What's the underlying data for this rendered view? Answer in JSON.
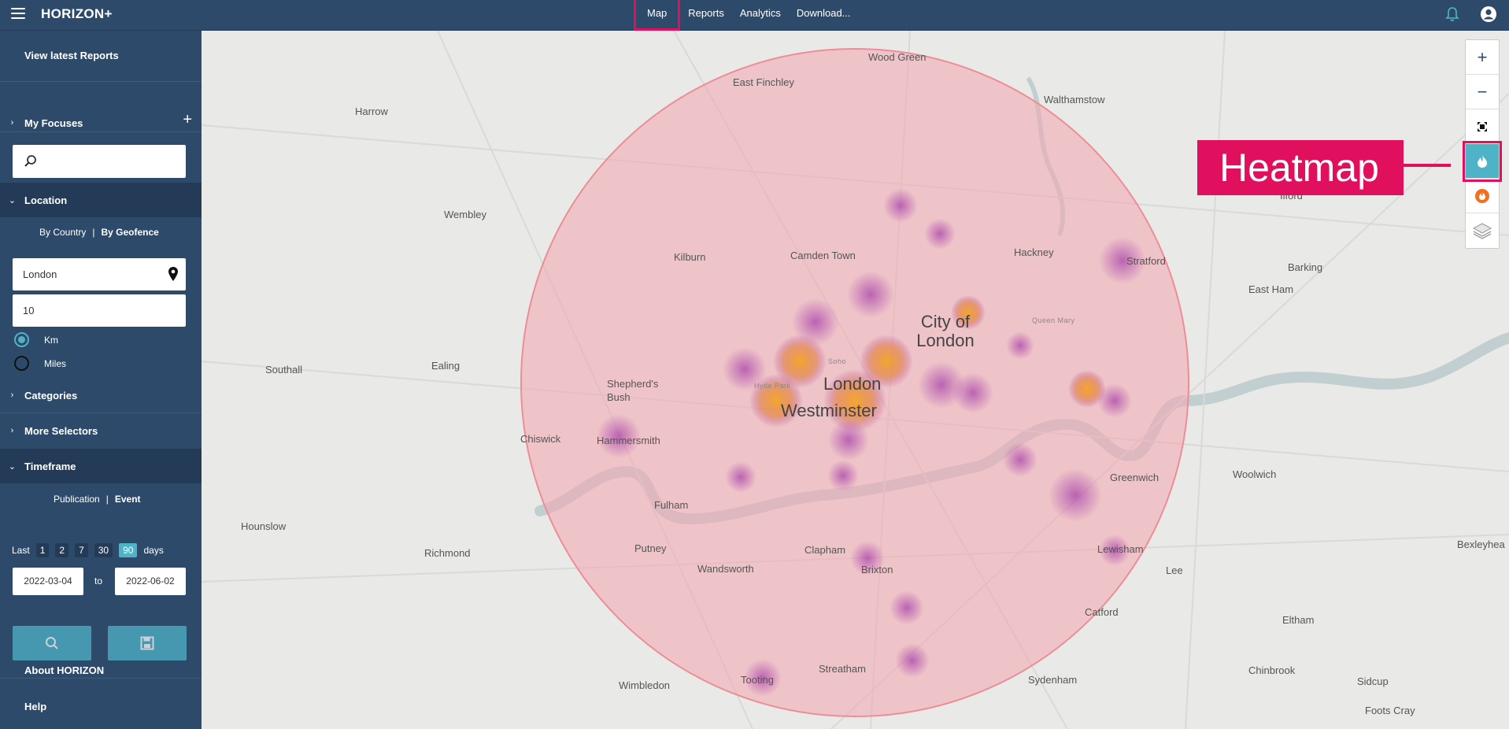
{
  "app": {
    "title": "HORIZON+"
  },
  "nav": {
    "items": [
      "Map",
      "Reports",
      "Analytics",
      "Download..."
    ],
    "active": "Map"
  },
  "sidebar": {
    "view_reports": "View latest Reports",
    "my_focuses": "My Focuses",
    "location": {
      "title": "Location",
      "by_country": "By Country",
      "separator": "|",
      "by_geofence": "By Geofence",
      "place_value": "London",
      "radius_value": "10",
      "units": [
        "Km",
        "Miles"
      ],
      "selected_unit": "Km"
    },
    "categories": "Categories",
    "more_selectors": "More Selectors",
    "timeframe": {
      "title": "Timeframe",
      "publication": "Publication",
      "separator": "|",
      "event": "Event",
      "last_label": "Last",
      "days_options": [
        "1",
        "2",
        "7",
        "30",
        "90"
      ],
      "selected_days": "90",
      "days_label": "days",
      "from_date": "2022-03-04",
      "to_label": "to",
      "to_date": "2022-06-02"
    },
    "about": "About HORIZON",
    "help": "Help"
  },
  "map": {
    "callout": "Heatmap",
    "controls": [
      "zoom-in",
      "zoom-out",
      "fullscreen",
      "heatmap",
      "hotspot",
      "layers"
    ],
    "places": [
      {
        "name": "Wood Green"
      },
      {
        "name": "East Finchley"
      },
      {
        "name": "Walthamstow"
      },
      {
        "name": "Harrow"
      },
      {
        "name": "Wembley"
      },
      {
        "name": "Kilburn"
      },
      {
        "name": "Camden Town"
      },
      {
        "name": "Hackney"
      },
      {
        "name": "Stratford"
      },
      {
        "name": "Barking"
      },
      {
        "name": "East Ham"
      },
      {
        "name": "Ilford"
      },
      {
        "name": "City of London"
      },
      {
        "name": "London"
      },
      {
        "name": "Westminster"
      },
      {
        "name": "Shepherd's Bush"
      },
      {
        "name": "Ealing"
      },
      {
        "name": "Southall"
      },
      {
        "name": "Chiswick"
      },
      {
        "name": "Hammersmith"
      },
      {
        "name": "Fulham"
      },
      {
        "name": "Hounslow"
      },
      {
        "name": "Richmond"
      },
      {
        "name": "Putney"
      },
      {
        "name": "Wandsworth"
      },
      {
        "name": "Clapham"
      },
      {
        "name": "Brixton"
      },
      {
        "name": "Streatham"
      },
      {
        "name": "Tooting"
      },
      {
        "name": "Wimbledon"
      },
      {
        "name": "Sydenham"
      },
      {
        "name": "Lewisham"
      },
      {
        "name": "Greenwich"
      },
      {
        "name": "Woolwich"
      },
      {
        "name": "Catford"
      },
      {
        "name": "Lee"
      },
      {
        "name": "Eltham"
      },
      {
        "name": "Chinbrook"
      },
      {
        "name": "Sidcup"
      },
      {
        "name": "Bexleyhea"
      },
      {
        "name": "Foots Cray"
      },
      {
        "name": "Soho"
      },
      {
        "name": "Hyde Park"
      },
      {
        "name": "Queen Mary"
      }
    ]
  }
}
